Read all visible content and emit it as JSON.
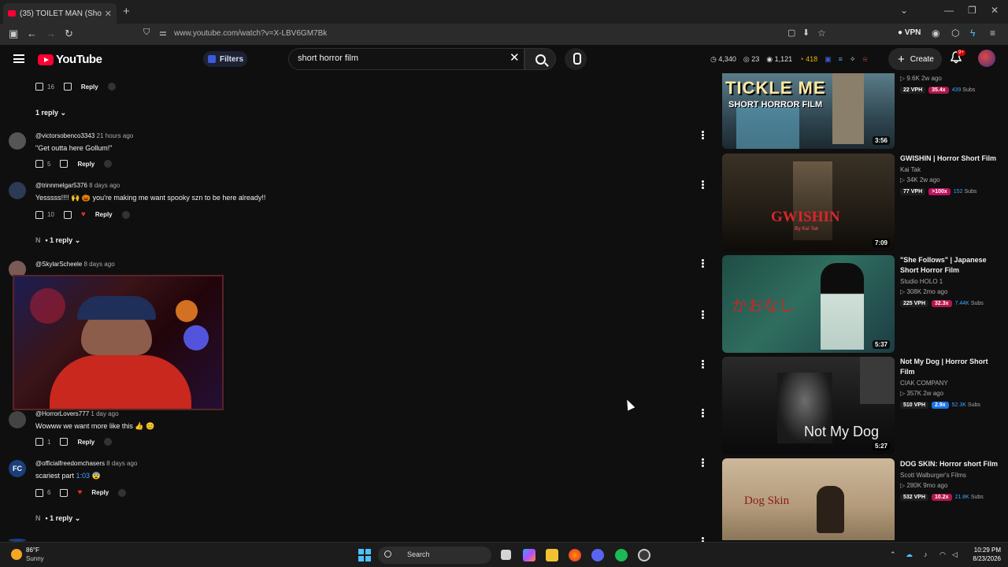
{
  "browser": {
    "tab_title": "(35) TOILET MAN (Short Horror",
    "url": "www.youtube.com/watch?v=X-LBV6GM7Bk",
    "vpn_label": "VPN"
  },
  "header": {
    "logo": "YouTube",
    "filters_label": "Filters",
    "search_value": "short horror film",
    "stats": [
      "4,340",
      "23",
      "1,121",
      "418"
    ],
    "create_label": "Create",
    "notif_badge": "9+"
  },
  "comments": [
    {
      "likes": "16",
      "reply": "Reply"
    },
    {
      "replies_label": "1 reply"
    },
    {
      "author": "@victorsobenco3343",
      "time": "21 hours ago",
      "text": "\"Get outta here Gollum!\"",
      "likes": "5",
      "reply": "Reply"
    },
    {
      "author": "@trinnmelgar5376",
      "time": "8 days ago",
      "text": "Yesssss!!!! 🙌 🎃 you're making me want spooky szn to be here already!!",
      "likes": "10",
      "reply": "Reply",
      "replies_label": "1 reply"
    },
    {
      "author": "@SkylarScheele",
      "time": "8 days ago"
    },
    {
      "author": "@HorrorLovers777",
      "time": "1 day ago",
      "text": "Wowww we want more like this 👍 😊",
      "likes": "1",
      "reply": "Reply"
    },
    {
      "author": "@officialfreedomchasers",
      "time": "8 days ago",
      "text_before": "scariest part ",
      "timestamp_link": "1:03",
      "text_after": " 😨",
      "likes": "6",
      "reply": "Reply",
      "replies_label": "1 reply"
    }
  ],
  "videos": [
    {
      "thumb_text_1": "TICKLE ME",
      "thumb_text_2": "SHORT HORROR FILM",
      "duration": "3:56",
      "meta": "9.6K  2w ago",
      "vph": "22 VPH",
      "mult": "35.4x",
      "mult_color": "#b3164a",
      "subs": "439",
      "subs_label": "Subs"
    },
    {
      "title": "GWISHIN | Horror Short Film",
      "channel": "Kai Tak",
      "meta": "34K  2w ago",
      "thumb_text_1": "GWISHIN",
      "thumb_text_2": "By Kai Tak",
      "duration": "7:09",
      "vph": "77 VPH",
      "mult": ">100x",
      "mult_color": "#c0105e",
      "subs": "152",
      "subs_label": "Subs"
    },
    {
      "title": "\"She Follows\" | Japanese Short Horror Film",
      "channel": "Studio HOLO 1",
      "meta": "308K  2mo ago",
      "thumb_text_1": "かおなし",
      "duration": "5:37",
      "vph": "225 VPH",
      "mult": "32.3x",
      "mult_color": "#b3164a",
      "subs": "7.44K",
      "subs_label": "Subs"
    },
    {
      "title": "Not My Dog | Horror Short Film",
      "channel": "CIAK COMPANY",
      "meta": "357K  2w ago",
      "thumb_text_1": "Not My Dog",
      "duration": "5:27",
      "vph": "510 VPH",
      "mult": "2.9x",
      "mult_color": "#1a73e8",
      "subs": "52.3K",
      "subs_label": "Subs"
    },
    {
      "title": "DOG SKIN: Horror short Film",
      "channel": "Scott Walburger's Films",
      "meta": "280K  9mo ago",
      "thumb_text_1": "Dog Skin",
      "vph": "532 VPH",
      "mult": "10.2x",
      "mult_color": "#b3164a",
      "subs": "21.8K",
      "subs_label": "Subs"
    }
  ],
  "taskbar": {
    "temp": "86°F",
    "weather": "Sunny",
    "search_label": "Search",
    "time": "10:29 PM",
    "date": "8/23/2026"
  }
}
